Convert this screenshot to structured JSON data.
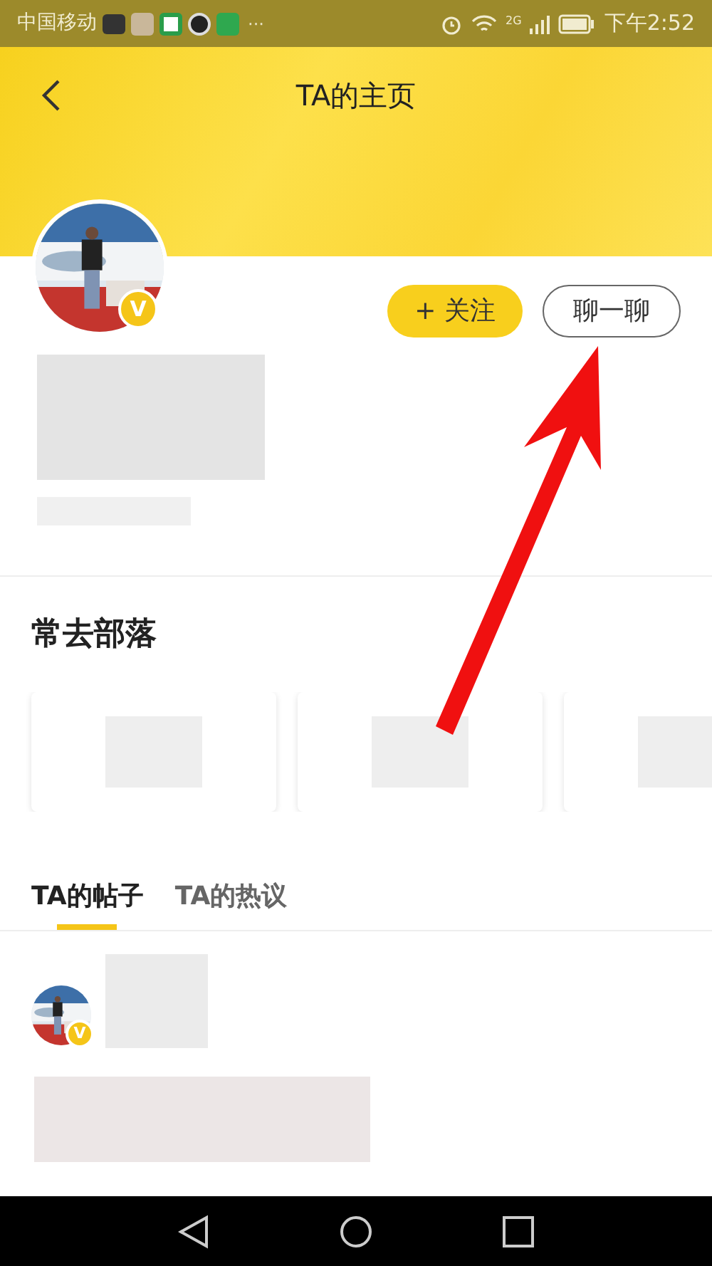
{
  "status_bar": {
    "carrier": "中国移动",
    "more": "···",
    "network": "2G",
    "time": "下午2:52"
  },
  "header": {
    "title": "TA的主页"
  },
  "profile": {
    "badge": "V",
    "follow_button": "+ 关注",
    "chat_button": "聊一聊"
  },
  "tribes": {
    "title": "常去部落",
    "cards": [
      {
        "kind": "card"
      },
      {
        "kind": "card"
      },
      {
        "kind": "card"
      }
    ]
  },
  "tabs": [
    {
      "label": "TA的帖子",
      "selected": true
    },
    {
      "label": "TA的热议",
      "selected": false
    }
  ],
  "post": {
    "badge": "V"
  }
}
